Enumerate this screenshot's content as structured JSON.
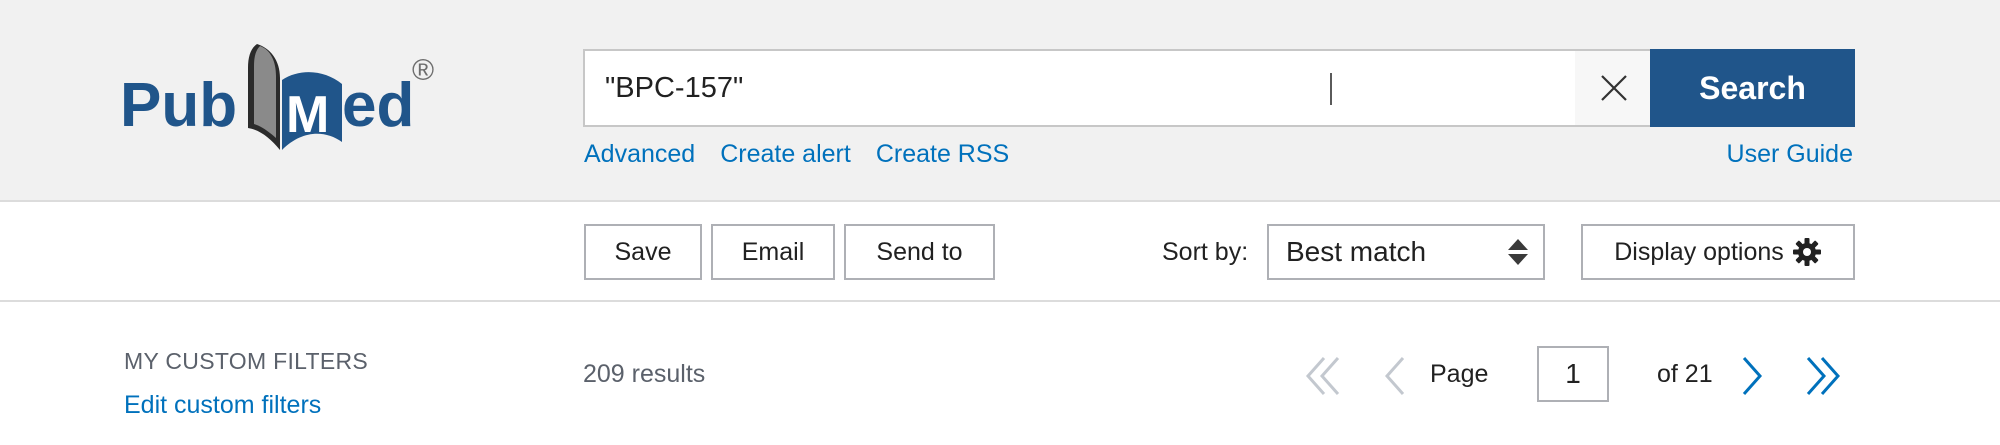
{
  "header": {
    "logo_text": "PubMed",
    "logo_mark": "®",
    "search": {
      "value": "\"BPC-157\"",
      "clear_icon": "close-icon",
      "button_label": "Search"
    },
    "links": {
      "advanced": "Advanced",
      "create_alert": "Create alert",
      "create_rss": "Create RSS",
      "user_guide": "User Guide"
    }
  },
  "actions": {
    "save": "Save",
    "email": "Email",
    "send_to": "Send to",
    "sort_label": "Sort by:",
    "sort_value": "Best match",
    "display_options": "Display options"
  },
  "sidebar": {
    "filters_title": "MY CUSTOM FILTERS",
    "edit_filters": "Edit custom filters"
  },
  "results": {
    "count_text": "209 results",
    "page_label": "Page",
    "current_page": "1",
    "of_text": "of 21"
  },
  "colors": {
    "accent": "#20558a",
    "link": "#0071bc",
    "header_bg": "#f1f1f1",
    "pager_disabled": "#c3c8cf",
    "pager_active": "#0071bc"
  }
}
